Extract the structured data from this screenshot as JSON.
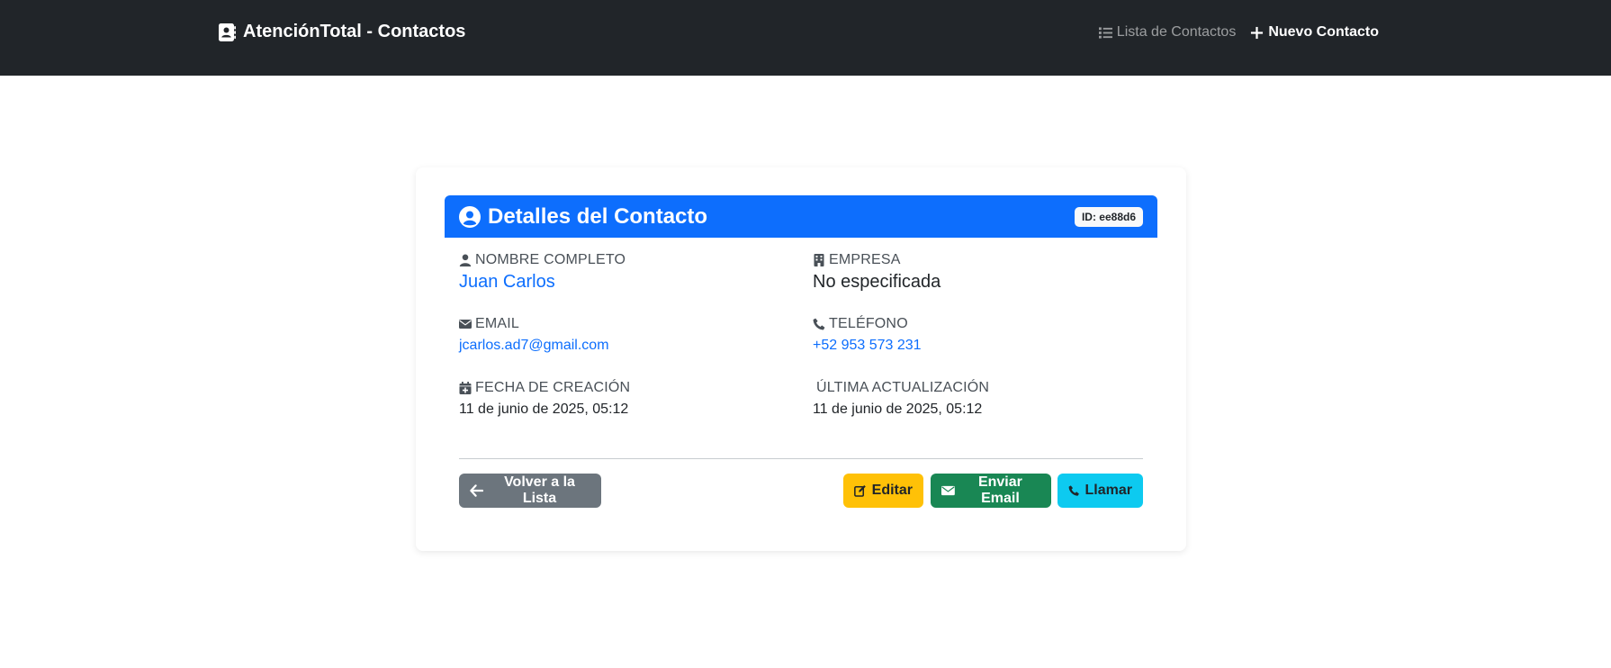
{
  "navbar": {
    "brand": "AtenciónTotal - Contactos",
    "links": [
      {
        "label": "Lista de Contactos",
        "icon": "list-icon",
        "active": false
      },
      {
        "label": "Nuevo Contacto",
        "icon": "plus-icon",
        "active": true
      }
    ]
  },
  "card": {
    "title": "Detalles del Contacto",
    "id_badge": "ID: ee88d6",
    "fields": {
      "nombre": {
        "label": "Nombre Completo",
        "value": "Juan Carlos",
        "icon": "user-icon"
      },
      "empresa": {
        "label": "Empresa",
        "value": "No especificada",
        "icon": "building-icon"
      },
      "email": {
        "label": "Email",
        "value": "jcarlos.ad7@gmail.com",
        "icon": "envelope-icon"
      },
      "telefono": {
        "label": "Teléfono",
        "value": "+52 953 573 231",
        "icon": "phone-icon"
      },
      "creacion": {
        "label": "Fecha de Creación",
        "value": "11 de junio de 2025, 05:12",
        "icon": "calendar-plus-icon"
      },
      "actualizacion": {
        "label": "Última Actualización",
        "value": "11 de junio de 2025, 05:12"
      }
    },
    "buttons": {
      "back": "Volver a la Lista",
      "edit": "Editar",
      "email": "Enviar Email",
      "call": "Llamar"
    }
  },
  "colors": {
    "navbar_bg": "#212529",
    "primary": "#0d6efd",
    "secondary": "#6c757d",
    "warning": "#ffc107",
    "success": "#198754",
    "info": "#0dcaf0"
  }
}
